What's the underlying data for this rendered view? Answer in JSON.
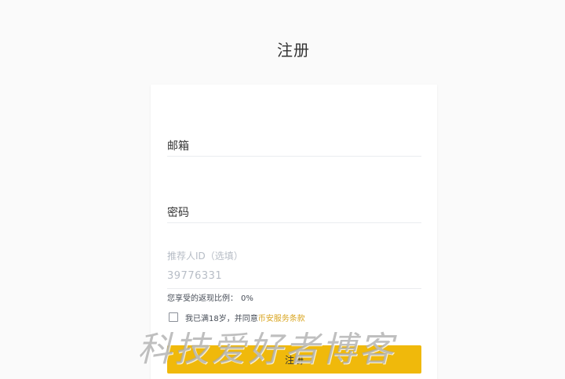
{
  "page": {
    "title": "注册"
  },
  "form": {
    "email_label": "邮箱",
    "email_value": "",
    "password_label": "密码",
    "password_value": "",
    "referral_label": "推荐人ID（选填）",
    "referral_value": "39776331",
    "rebate_label": "您享受的返现比例：",
    "rebate_value": "0%",
    "agree_text": "我已满18岁，并同意",
    "terms_link": "币安服务条款",
    "agree_checked": false,
    "submit_label": "注册"
  },
  "watermark": {
    "text": "科技爱好者博客"
  },
  "colors": {
    "background": "#fafafa",
    "card": "#ffffff",
    "accent": "#f0b90b",
    "link": "#d9a520",
    "muted": "#b7bdc6"
  }
}
